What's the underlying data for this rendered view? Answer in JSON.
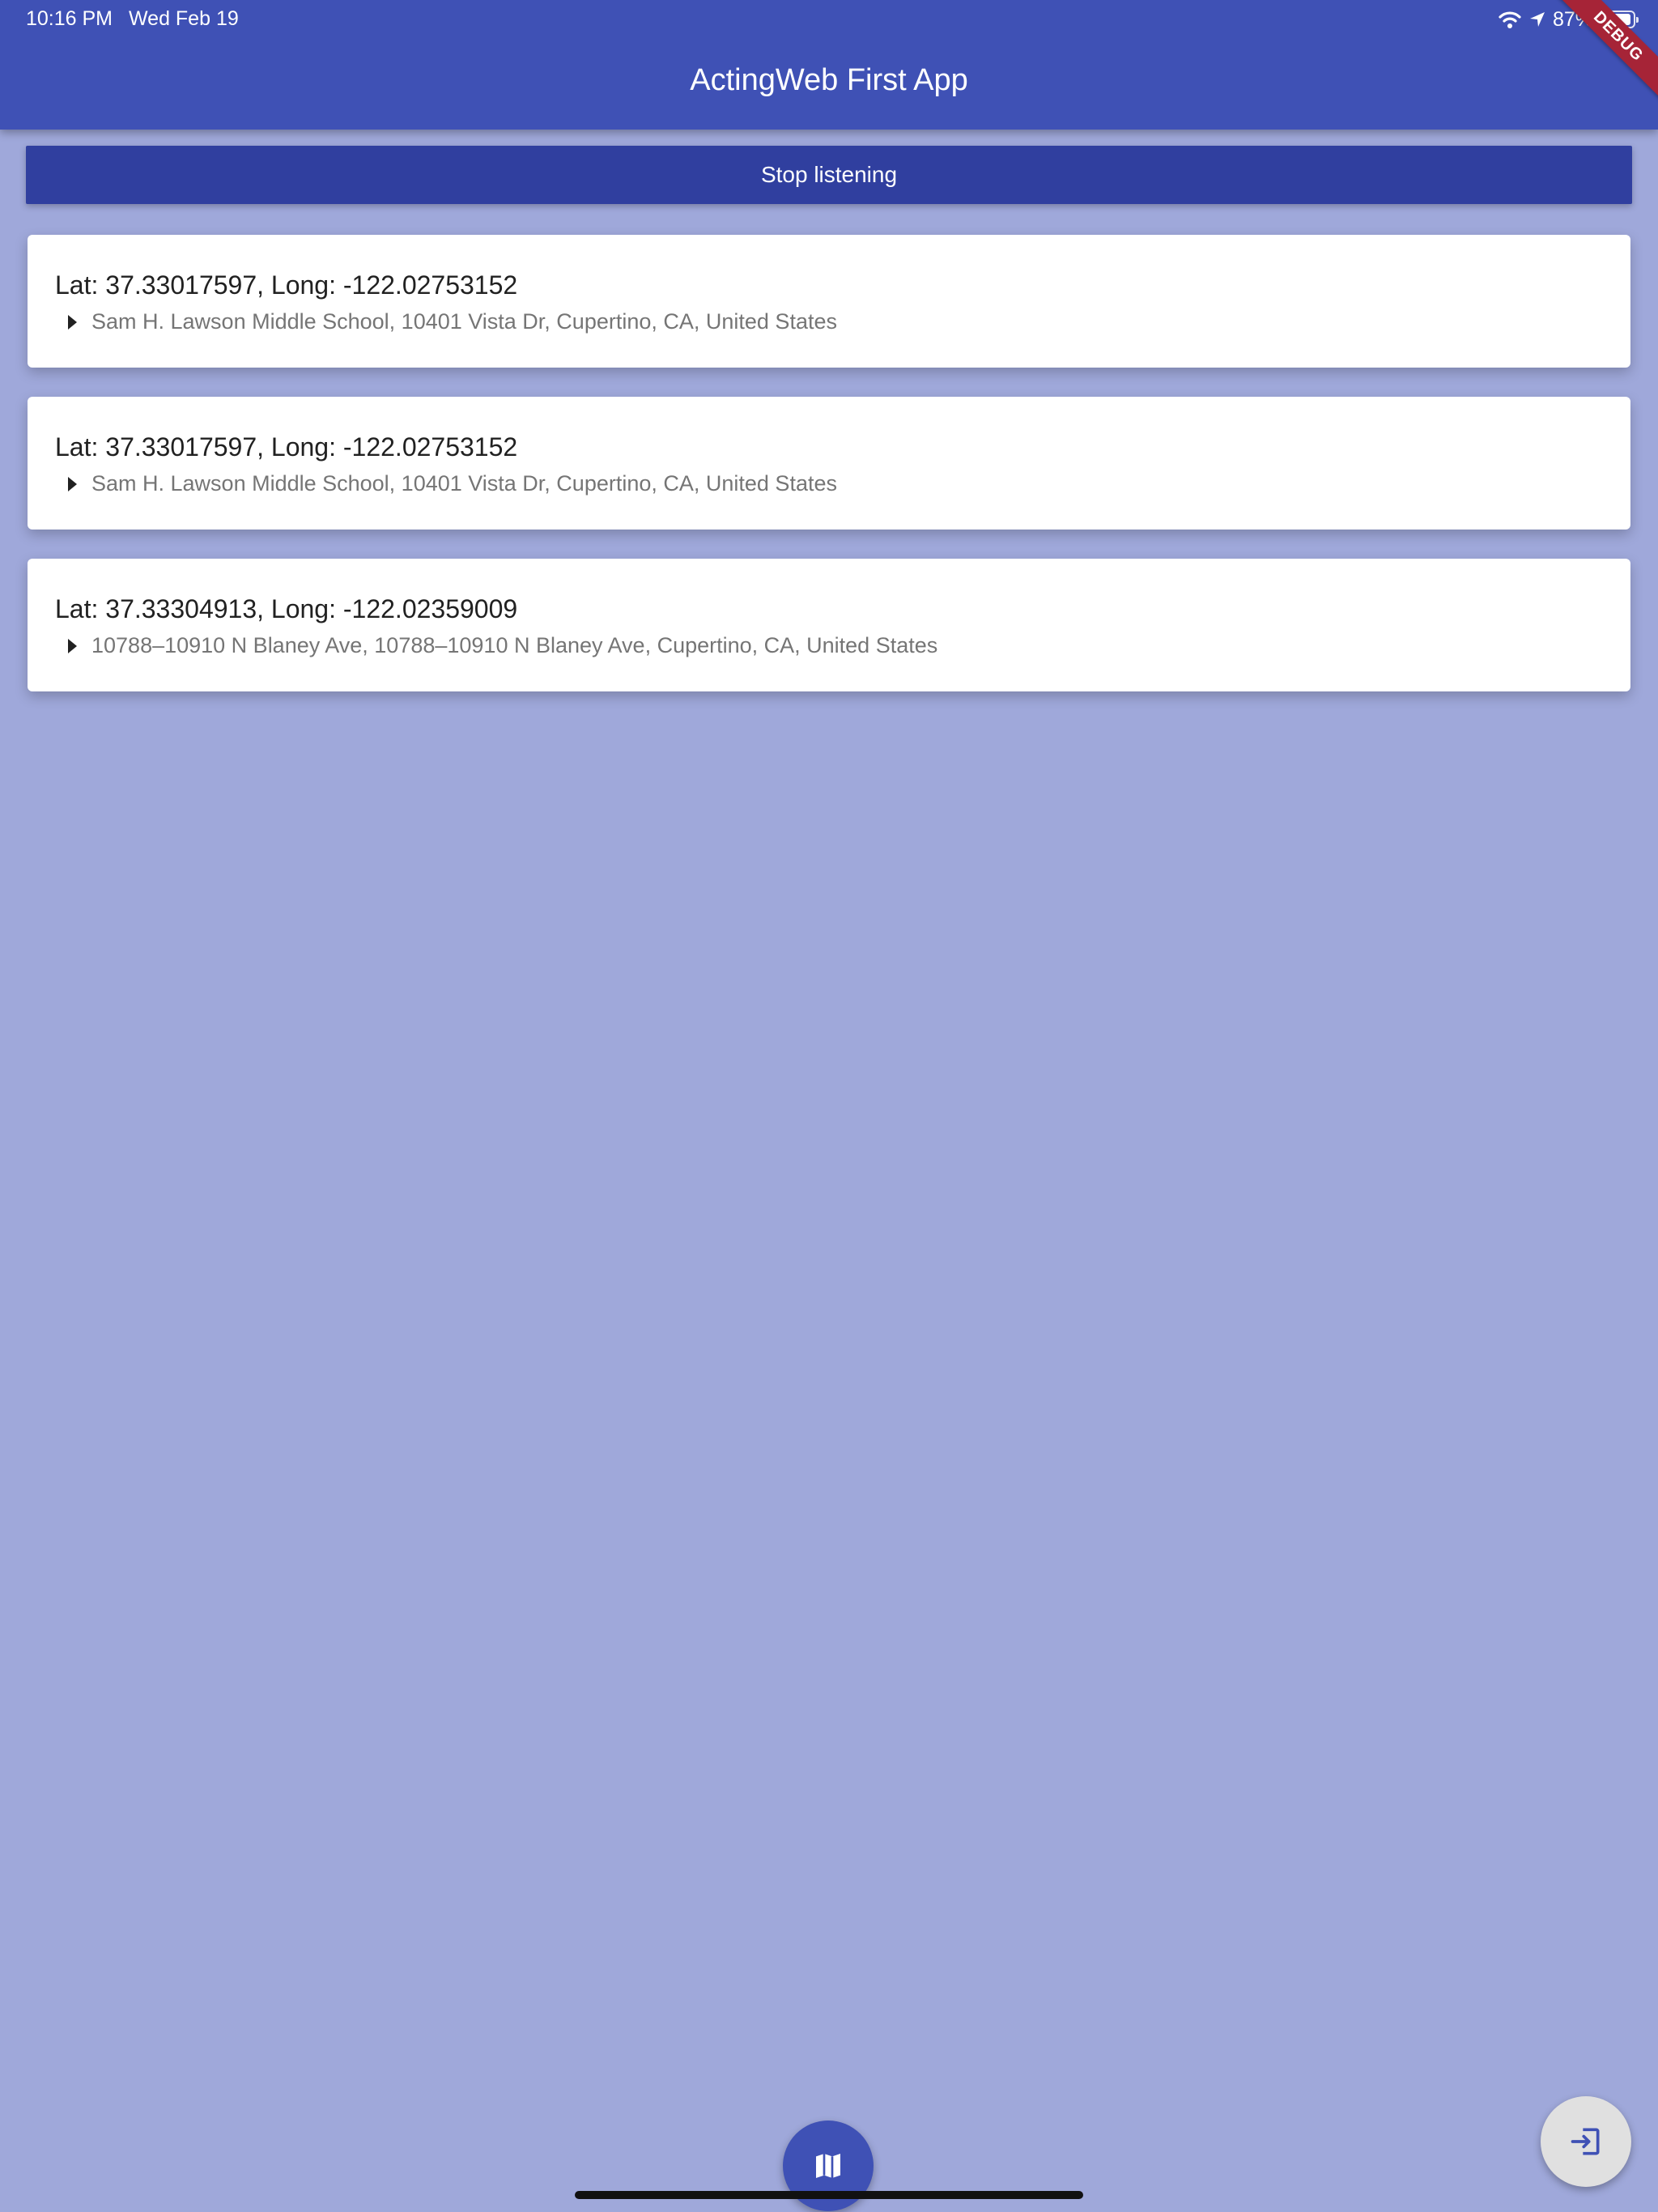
{
  "status_bar": {
    "time": "10:16 PM",
    "date": "Wed Feb 19",
    "battery_percent": "87%",
    "battery_level": 0.87,
    "icons": [
      "wifi-icon",
      "location-arrow-icon",
      "battery-icon"
    ]
  },
  "app_bar": {
    "title": "ActingWeb First App",
    "debug_banner": "DEBUG",
    "color": "#3f51b5"
  },
  "main": {
    "stop_button_label": "Stop listening",
    "locations": [
      {
        "coords": "Lat: 37.33017597, Long: -122.02753152",
        "address": "Sam H. Lawson Middle School, 10401 Vista Dr, Cupertino, CA, United States"
      },
      {
        "coords": "Lat: 37.33017597, Long: -122.02753152",
        "address": "Sam H. Lawson Middle School, 10401 Vista Dr, Cupertino, CA, United States"
      },
      {
        "coords": "Lat: 37.33304913, Long: -122.02359009",
        "address": "10788–10910 N Blaney Ave, 10788–10910 N Blaney Ave, Cupertino, CA, United States"
      }
    ]
  },
  "fabs": {
    "map_icon": "map-icon",
    "exit_icon": "exit-to-app-icon"
  },
  "colors": {
    "background": "#9fa8da",
    "primary": "#3f51b5",
    "primary_dark": "#303f9f",
    "debug": "#a62437"
  }
}
